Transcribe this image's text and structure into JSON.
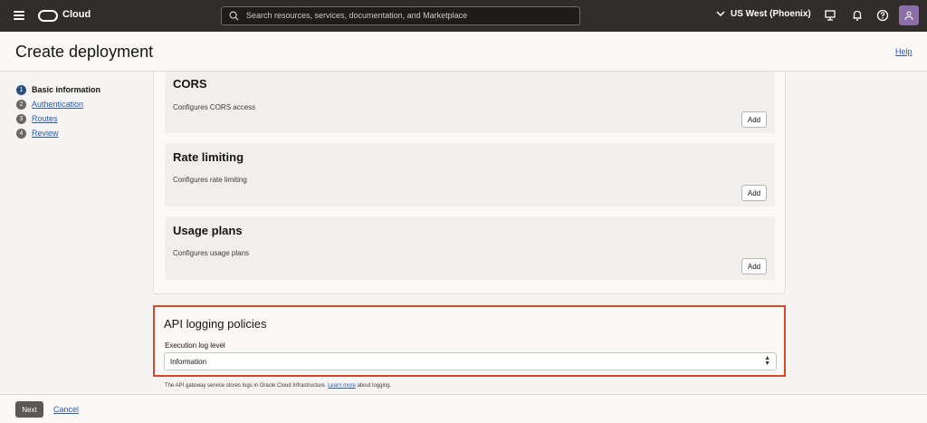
{
  "topbar": {
    "brand": "Cloud",
    "search_placeholder": "Search resources, services, documentation, and Marketplace",
    "region": "US West (Phoenix)",
    "icons": [
      "menu-icon",
      "oracle-logo",
      "search-icon",
      "chevron-down-icon",
      "console-icon",
      "bell-icon",
      "help-icon",
      "user-icon"
    ]
  },
  "header": {
    "title": "Create deployment",
    "help": "Help"
  },
  "steps": [
    {
      "num": "1",
      "label": "Basic information",
      "active": true
    },
    {
      "num": "2",
      "label": "Authentication",
      "active": false
    },
    {
      "num": "3",
      "label": "Routes",
      "active": false
    },
    {
      "num": "4",
      "label": "Review",
      "active": false
    }
  ],
  "policies": [
    {
      "title": "CORS",
      "description": "Configures CORS access",
      "button": "Add"
    },
    {
      "title": "Rate limiting",
      "description": "Configures rate limiting",
      "button": "Add"
    },
    {
      "title": "Usage plans",
      "description": "Configures usage plans",
      "button": "Add"
    }
  ],
  "logging": {
    "title": "API logging policies",
    "exec_label": "Execution log level",
    "exec_value": "Information",
    "note_prefix": "The API gateway service stores logs in Oracle Cloud Infrastructure.",
    "note_link": "Learn more",
    "note_suffix": "about logging."
  },
  "footer": {
    "next": "Next",
    "cancel": "Cancel"
  },
  "colors": {
    "topbar": "#312d2a",
    "highlight_border": "#d9472b",
    "link": "#2c5bb0",
    "avatar": "#8a6ea5"
  }
}
